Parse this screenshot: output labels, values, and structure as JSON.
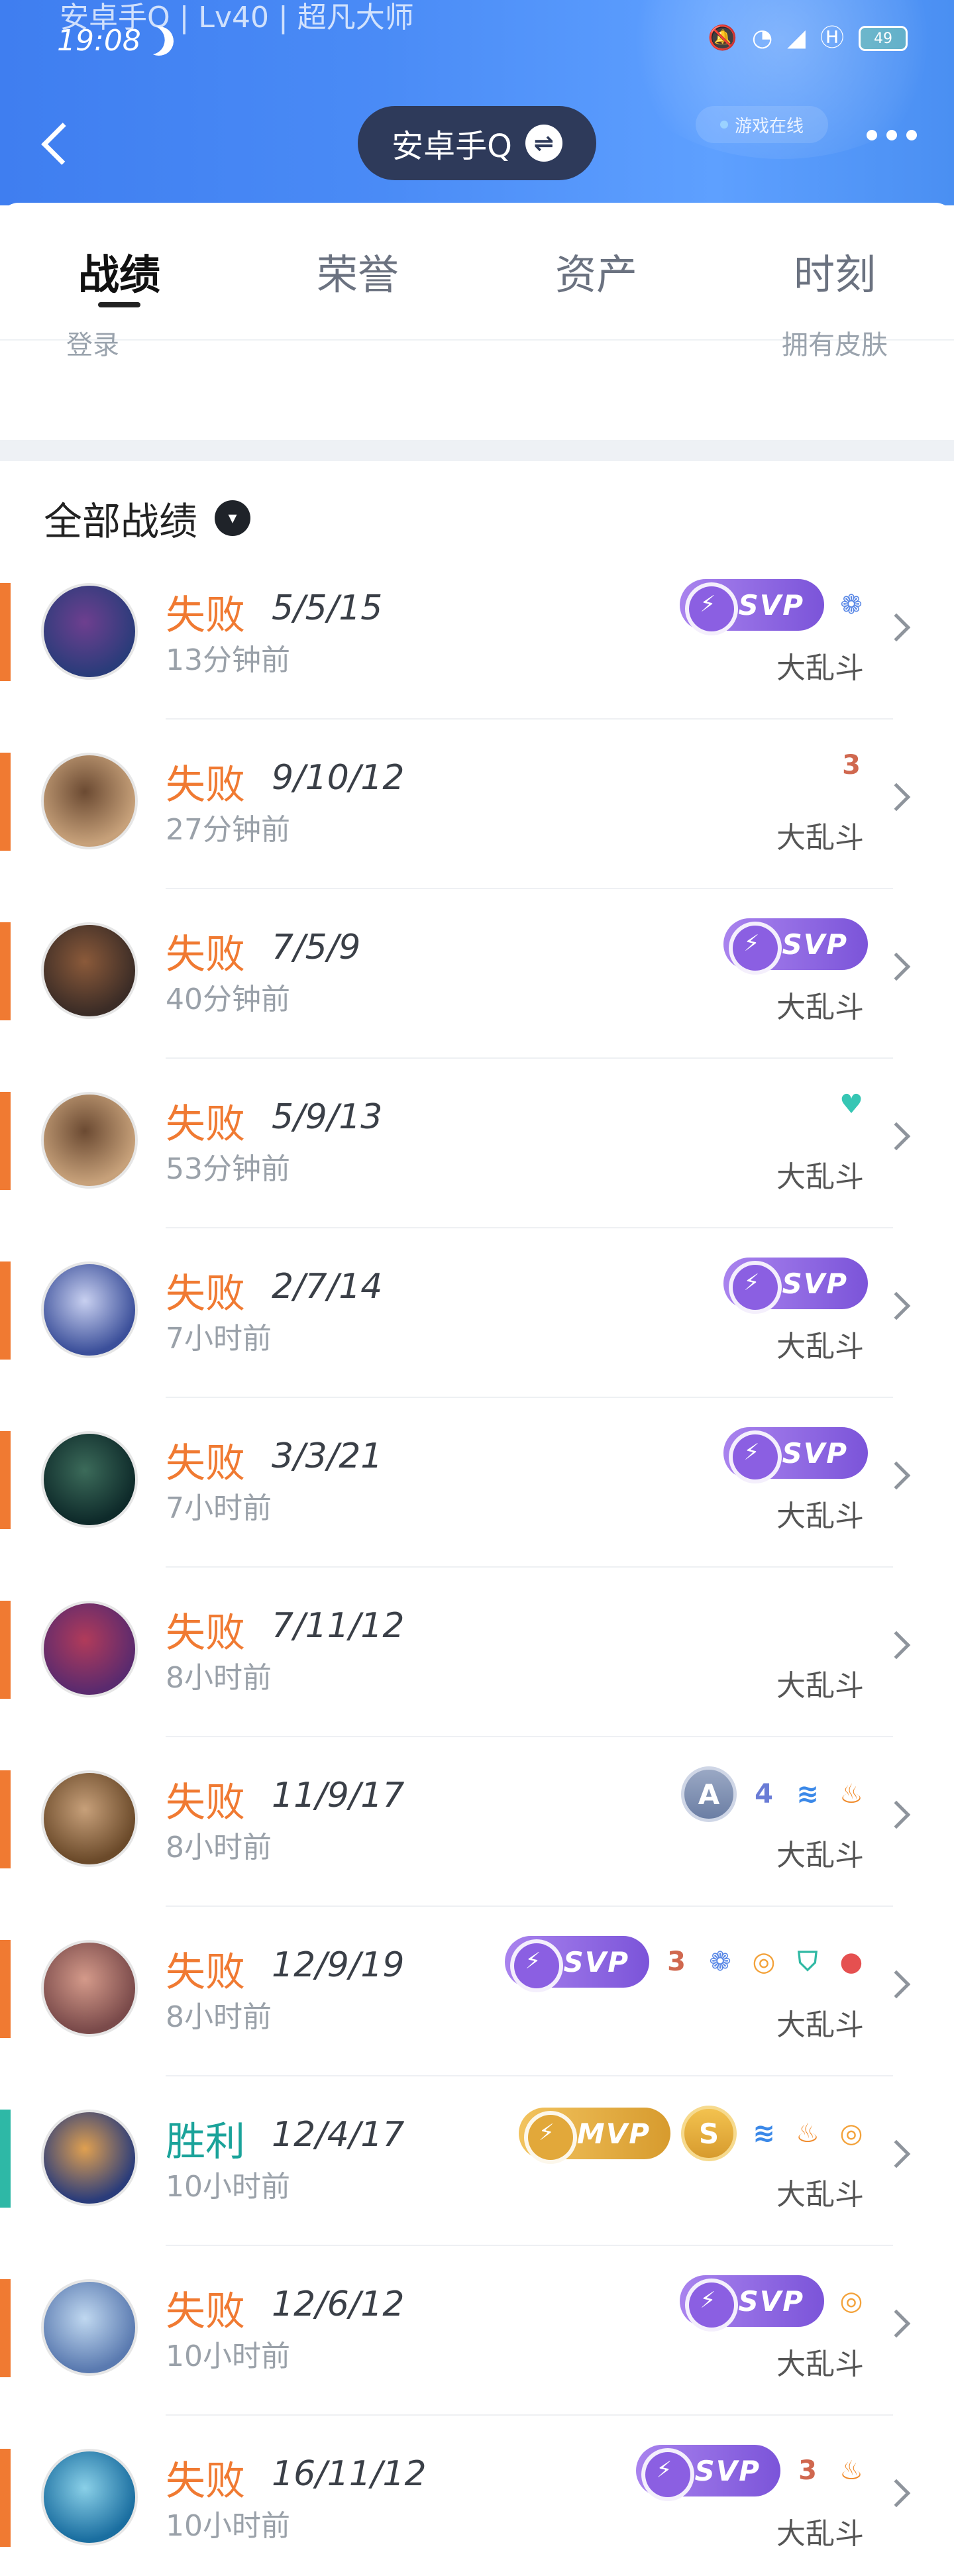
{
  "status_bar": {
    "top_text": "安卓手Q | Lv40 | 超凡大师",
    "time": "19:08",
    "battery": "49",
    "game_online": "游戏在线"
  },
  "header": {
    "account_name": "安卓手Q",
    "swap_symbol": "⇌"
  },
  "tabs": [
    "战绩",
    "荣誉",
    "资产",
    "时刻"
  ],
  "partial_strip": {
    "left": "登录",
    "right": "拥有皮肤"
  },
  "section": {
    "title": "全部战绩",
    "caret": "▾"
  },
  "colors": {
    "loss": "#f07a32",
    "win": "#2eb8a6",
    "svp": "#8b5fe2",
    "mvp": "#e2a83a",
    "header": "#4a8bf6"
  },
  "matches": [
    {
      "result": "失败",
      "kda": "5/5/15",
      "time": "13分钟前",
      "mode": "大乱斗",
      "badges": [
        "svp",
        "lotus"
      ]
    },
    {
      "result": "失败",
      "kda": "9/10/12",
      "time": "27分钟前",
      "mode": "大乱斗",
      "badges": [
        "three"
      ]
    },
    {
      "result": "失败",
      "kda": "7/5/9",
      "time": "40分钟前",
      "mode": "大乱斗",
      "badges": [
        "svp"
      ]
    },
    {
      "result": "失败",
      "kda": "5/9/13",
      "time": "53分钟前",
      "mode": "大乱斗",
      "badges": [
        "heart"
      ]
    },
    {
      "result": "失败",
      "kda": "2/7/14",
      "time": "7小时前",
      "mode": "大乱斗",
      "badges": [
        "svp"
      ]
    },
    {
      "result": "失败",
      "kda": "3/3/21",
      "time": "7小时前",
      "mode": "大乱斗",
      "badges": [
        "svp"
      ]
    },
    {
      "result": "失败",
      "kda": "7/11/12",
      "time": "8小时前",
      "mode": "大乱斗",
      "badges": []
    },
    {
      "result": "失败",
      "kda": "11/9/17",
      "time": "8小时前",
      "mode": "大乱斗",
      "badges": [
        "a",
        "four",
        "wave",
        "fire"
      ]
    },
    {
      "result": "失败",
      "kda": "12/9/19",
      "time": "8小时前",
      "mode": "大乱斗",
      "badges": [
        "svp",
        "three",
        "lotus",
        "coin",
        "shield",
        "drop"
      ]
    },
    {
      "result": "胜利",
      "kda": "12/4/17",
      "time": "10小时前",
      "mode": "大乱斗",
      "badges": [
        "mvp",
        "s",
        "wave",
        "fire",
        "coin"
      ]
    },
    {
      "result": "失败",
      "kda": "12/6/12",
      "time": "10小时前",
      "mode": "大乱斗",
      "badges": [
        "svp",
        "coin"
      ]
    },
    {
      "result": "失败",
      "kda": "16/11/12",
      "time": "10小时前",
      "mode": "大乱斗",
      "badges": [
        "svp",
        "three",
        "fire"
      ]
    }
  ],
  "badge_labels": {
    "svp": "SVP",
    "mvp": "MVP",
    "a": "A",
    "s": "S",
    "three": "3",
    "four": "4"
  },
  "icon_names": {
    "lotus": "lotus-icon",
    "three": "triple-kill-icon",
    "four": "quadra-kill-icon",
    "wave": "wave-icon",
    "fire": "fire-icon",
    "coin": "coin-icon",
    "heart": "heart-plus-icon",
    "shield": "shield-icon",
    "drop": "blood-drop-icon"
  }
}
